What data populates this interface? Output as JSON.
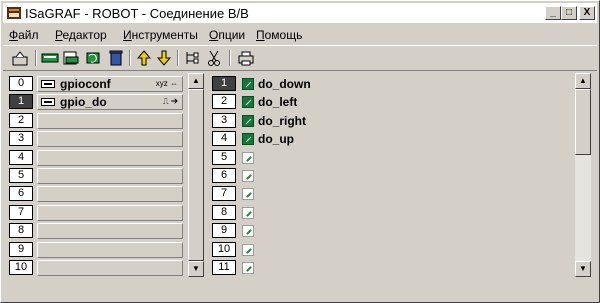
{
  "window": {
    "title": "ISaGRAF - ROBOT - Соединение В/В",
    "controls": [
      "_",
      "□",
      "X"
    ]
  },
  "menu": [
    {
      "label": "Файл",
      "accel": "Ф",
      "rest": "айл"
    },
    {
      "label": "Редактор",
      "accel": "Р",
      "rest": "едактор"
    },
    {
      "label": "Инструменты",
      "accel": "И",
      "rest": "нструменты"
    },
    {
      "label": "Опции",
      "accel": "О",
      "rest": "пции"
    },
    {
      "label": "Помощь",
      "accel": "П",
      "rest": "омощь"
    }
  ],
  "toolbar": {
    "icons": [
      "save-icon",
      "board-connect-icon",
      "board-edit-icon",
      "board-refresh-icon",
      "delete-icon",
      "move-up-icon",
      "move-down-icon",
      "tree-icon",
      "scissors-icon",
      "print-icon"
    ]
  },
  "left_list": {
    "rows": [
      {
        "num": "0",
        "label": "gpioconf",
        "tag": "xyz ⇔",
        "selected": false,
        "filled": true
      },
      {
        "num": "1",
        "label": "gpio_do",
        "tag": "⎍ ➔",
        "selected": true,
        "filled": true
      },
      {
        "num": "2",
        "label": "",
        "tag": "",
        "selected": false,
        "filled": false
      },
      {
        "num": "3",
        "label": "",
        "tag": "",
        "selected": false,
        "filled": false
      },
      {
        "num": "4",
        "label": "",
        "tag": "",
        "selected": false,
        "filled": false
      },
      {
        "num": "5",
        "label": "",
        "tag": "",
        "selected": false,
        "filled": false
      },
      {
        "num": "6",
        "label": "",
        "tag": "",
        "selected": false,
        "filled": false
      },
      {
        "num": "7",
        "label": "",
        "tag": "",
        "selected": false,
        "filled": false
      },
      {
        "num": "8",
        "label": "",
        "tag": "",
        "selected": false,
        "filled": false
      },
      {
        "num": "9",
        "label": "",
        "tag": "",
        "selected": false,
        "filled": false
      },
      {
        "num": "10",
        "label": "",
        "tag": "",
        "selected": false,
        "filled": false
      }
    ]
  },
  "right_list": {
    "rows": [
      {
        "num": "1",
        "label": "do_down",
        "connected": true,
        "selected": true
      },
      {
        "num": "2",
        "label": "do_left",
        "connected": true,
        "selected": false
      },
      {
        "num": "3",
        "label": "do_right",
        "connected": true,
        "selected": false
      },
      {
        "num": "4",
        "label": "do_up",
        "connected": true,
        "selected": false
      },
      {
        "num": "5",
        "label": "",
        "connected": false,
        "selected": false
      },
      {
        "num": "6",
        "label": "",
        "connected": false,
        "selected": false
      },
      {
        "num": "7",
        "label": "",
        "connected": false,
        "selected": false
      },
      {
        "num": "8",
        "label": "",
        "connected": false,
        "selected": false
      },
      {
        "num": "9",
        "label": "",
        "connected": false,
        "selected": false
      },
      {
        "num": "10",
        "label": "",
        "connected": false,
        "selected": false
      },
      {
        "num": "11",
        "label": "",
        "connected": false,
        "selected": false
      }
    ]
  },
  "scroll_glyphs": {
    "up": "▲",
    "down": "▼"
  }
}
